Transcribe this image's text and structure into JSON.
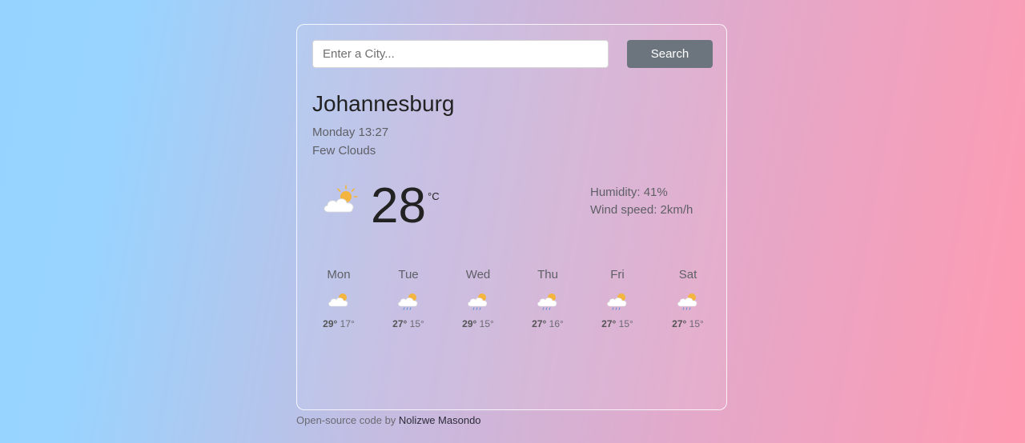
{
  "search": {
    "placeholder": "Enter a City...",
    "value": "",
    "button_label": "Search"
  },
  "current": {
    "city": "Johannesburg",
    "datetime": "Monday 13:27",
    "description": "Few Clouds",
    "icon": "sun-behind-cloud-icon",
    "temperature": "28",
    "unit": "°C",
    "humidity_label": "Humidity: ",
    "humidity": "41%",
    "wind_label": "Wind speed: ",
    "wind": "2km/h"
  },
  "forecast": [
    {
      "day": "Mon",
      "icon": "partly-cloudy-icon",
      "max": "29°",
      "min": "17°"
    },
    {
      "day": "Tue",
      "icon": "rain-cloud-icon",
      "max": "27°",
      "min": "15°"
    },
    {
      "day": "Wed",
      "icon": "rain-cloud-icon",
      "max": "29°",
      "min": "15°"
    },
    {
      "day": "Thu",
      "icon": "rain-cloud-icon",
      "max": "27°",
      "min": "16°"
    },
    {
      "day": "Fri",
      "icon": "rain-cloud-icon",
      "max": "27°",
      "min": "15°"
    },
    {
      "day": "Sat",
      "icon": "rain-cloud-icon",
      "max": "27°",
      "min": "15°"
    }
  ],
  "footer": {
    "source_text": "Open-source code",
    "by_text": " by ",
    "author": "Nolizwe Masondo"
  },
  "colors": {
    "button": "#6c757d",
    "sun": "#f3b53f",
    "cloud": "#ffffff",
    "rain": "#5b8fd6"
  }
}
